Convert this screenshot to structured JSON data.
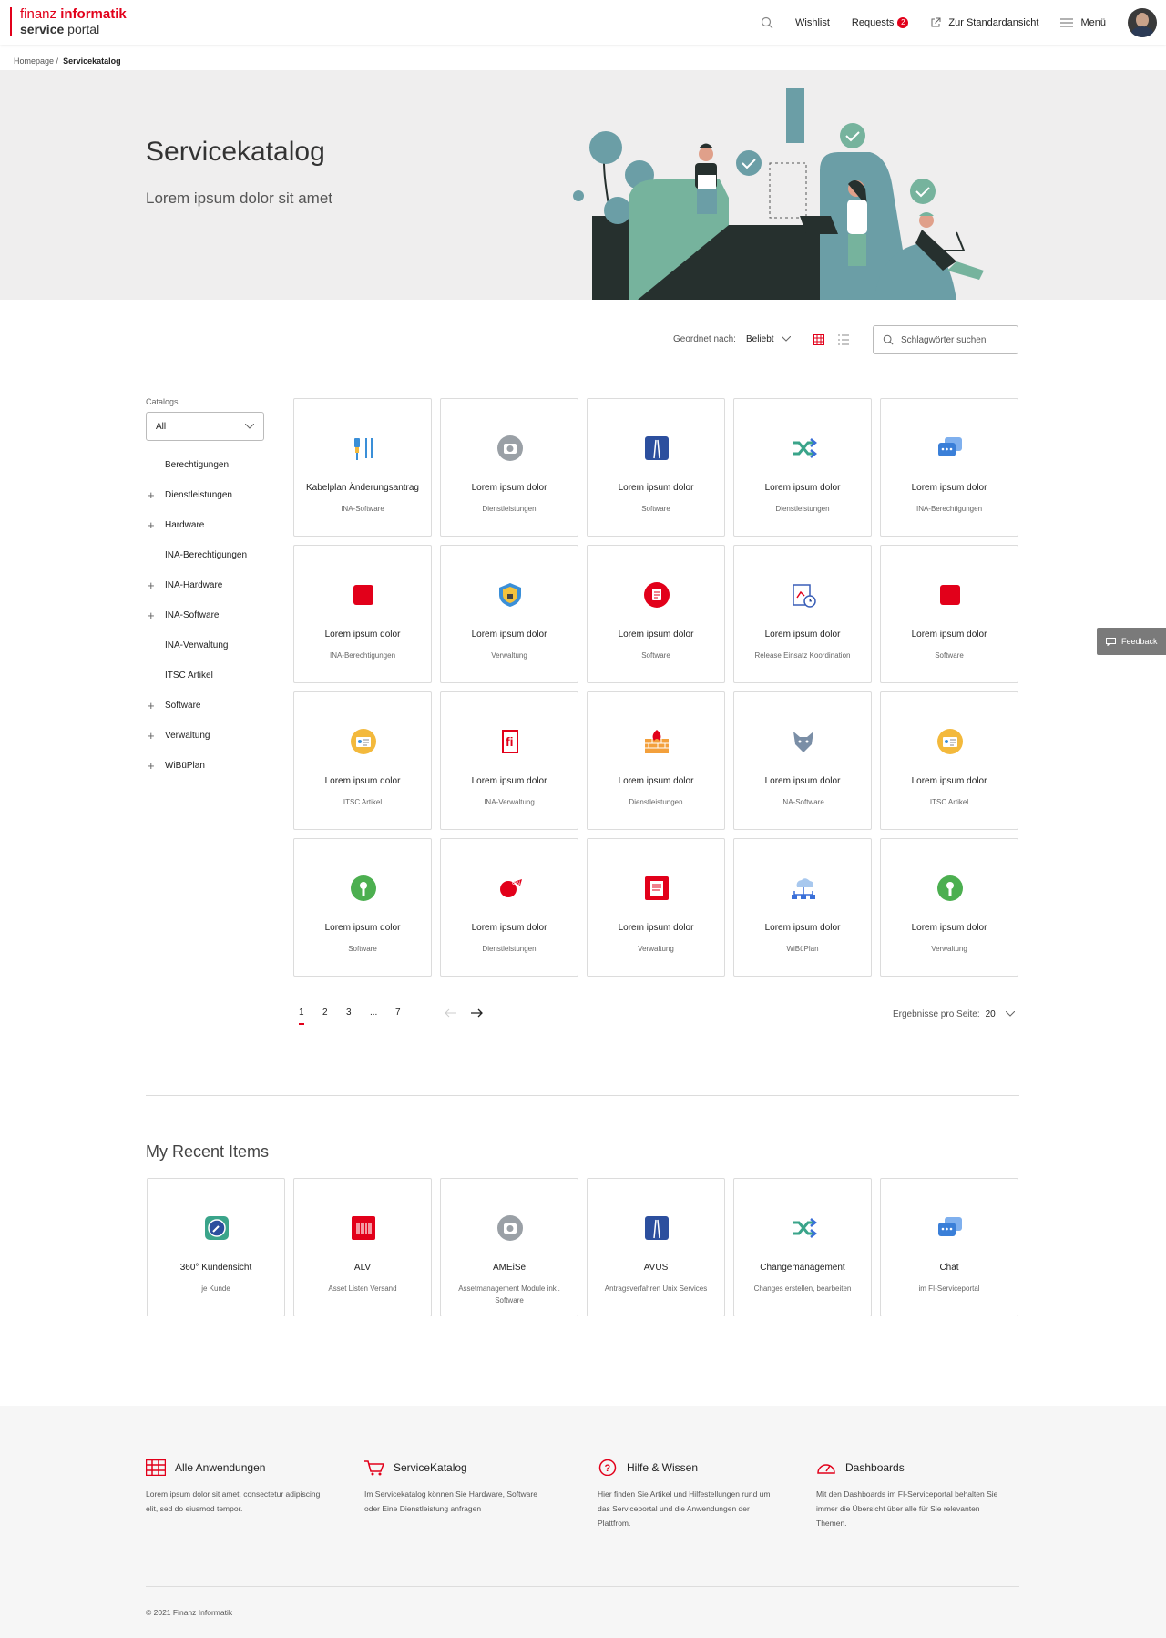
{
  "header": {
    "logo_line1_light": "finanz ",
    "logo_line1_bold": "informatik",
    "logo_line2_bold": "service",
    "logo_line2_light": " portal",
    "wishlist": "Wishlist",
    "requests": "Requests",
    "requests_badge": "2",
    "standard_view": "Zur Standardansicht",
    "menu": "Menü"
  },
  "breadcrumb": {
    "home": "Homepage",
    "sep": "/",
    "current": "Servicekatalog"
  },
  "hero": {
    "title": "Servicekatalog",
    "subtitle": "Lorem ipsum dolor sit amet"
  },
  "toolbar": {
    "sort_label": "Geordnet nach:",
    "sort_value": "Beliebt",
    "search_placeholder": "Schlagwörter suchen"
  },
  "sidebar": {
    "label": "Catalogs",
    "select_value": "All",
    "items": [
      {
        "label": "Berechtigungen",
        "expand": false
      },
      {
        "label": "Dienstleistungen",
        "expand": true
      },
      {
        "label": "Hardware",
        "expand": true
      },
      {
        "label": "INA-Berechtigungen",
        "expand": false
      },
      {
        "label": "INA-Hardware",
        "expand": true
      },
      {
        "label": "INA-Software",
        "expand": true
      },
      {
        "label": "INA-Verwaltung",
        "expand": false
      },
      {
        "label": "ITSC Artikel",
        "expand": false
      },
      {
        "label": "Software",
        "expand": true
      },
      {
        "label": "Verwaltung",
        "expand": true
      },
      {
        "label": "WiBüPlan",
        "expand": true
      }
    ]
  },
  "catalog": [
    {
      "title": "Kabelplan Änderungsantrag",
      "sub": "INA-Software",
      "icon": "cable-icon"
    },
    {
      "title": "Lorem ipsum dolor",
      "sub": "Dienstleistungen",
      "icon": "camera-icon"
    },
    {
      "title": "Lorem ipsum dolor",
      "sub": "Software",
      "icon": "road-icon"
    },
    {
      "title": "Lorem ipsum dolor",
      "sub": "Dienstleistungen",
      "icon": "shuffle-icon"
    },
    {
      "title": "Lorem ipsum dolor",
      "sub": "INA-Berechtigungen",
      "icon": "chat-icon"
    },
    {
      "title": "Lorem ipsum dolor",
      "sub": "INA-Berechtigungen",
      "icon": "red-square-icon"
    },
    {
      "title": "Lorem ipsum dolor",
      "sub": "Verwaltung",
      "icon": "shield-icon"
    },
    {
      "title": "Lorem ipsum dolor",
      "sub": "Software",
      "icon": "document-circle-icon"
    },
    {
      "title": "Lorem ipsum dolor",
      "sub": "Release Einsatz Koordination",
      "icon": "clipboard-clock-icon"
    },
    {
      "title": "Lorem ipsum dolor",
      "sub": "Software",
      "icon": "red-square-icon"
    },
    {
      "title": "Lorem ipsum dolor",
      "sub": "ITSC Artikel",
      "icon": "id-card-icon"
    },
    {
      "title": "Lorem ipsum dolor",
      "sub": "INA-Verwaltung",
      "icon": "fi-logo-icon"
    },
    {
      "title": "Lorem ipsum dolor",
      "sub": "Dienstleistungen",
      "icon": "firewall-icon"
    },
    {
      "title": "Lorem ipsum dolor",
      "sub": "INA-Software",
      "icon": "wolf-icon"
    },
    {
      "title": "Lorem ipsum dolor",
      "sub": "ITSC Artikel",
      "icon": "id-card-icon"
    },
    {
      "title": "Lorem ipsum dolor",
      "sub": "Software",
      "icon": "open-source-icon"
    },
    {
      "title": "Lorem ipsum dolor",
      "sub": "Dienstleistungen",
      "icon": "stamp-icon"
    },
    {
      "title": "Lorem ipsum dolor",
      "sub": "Verwaltung",
      "icon": "document-red-icon"
    },
    {
      "title": "Lorem ipsum dolor",
      "sub": "WiBüPlan",
      "icon": "cloud-network-icon"
    },
    {
      "title": "Lorem ipsum dolor",
      "sub": "Verwaltung",
      "icon": "open-source-icon"
    }
  ],
  "pagination": {
    "pages": [
      "1",
      "2",
      "3",
      "...",
      "7"
    ],
    "per_page_label": "Ergebnisse pro Seite:",
    "per_page_value": "20"
  },
  "recent": {
    "title": "My Recent Items",
    "items": [
      {
        "title": "360° Kundensicht",
        "sub": "je Kunde",
        "icon": "compass-icon"
      },
      {
        "title": "ALV",
        "sub": "Asset Listen Versand",
        "icon": "barcode-icon"
      },
      {
        "title": "AMEiSe",
        "sub": "Assetmanagement Module inkl. Software",
        "icon": "camera-icon"
      },
      {
        "title": "AVUS",
        "sub": "Antragsverfahren Unix Services",
        "icon": "road-icon"
      },
      {
        "title": "Changemanagement",
        "sub": "Changes erstellen, bearbeiten",
        "icon": "shuffle-icon"
      },
      {
        "title": "Chat",
        "sub": "im FI-Serviceportal",
        "icon": "chat-icon"
      }
    ]
  },
  "footer": {
    "cols": [
      {
        "title": "Alle Anwendungen",
        "text": "Lorem ipsum dolor sit amet, consectetur adipiscing elit, sed do eiusmod tempor.",
        "icon": "grid-icon"
      },
      {
        "title": "ServiceKatalog",
        "text": "Im Servicekatalog können Sie Hardware, Software oder Eine Dienstleistung anfragen",
        "icon": "cart-icon"
      },
      {
        "title": "Hilfe & Wissen",
        "text": "Hier finden Sie Artikel und Hilfestellungen rund um das Serviceportal und die Anwendungen der Plattfrom.",
        "icon": "help-icon"
      },
      {
        "title": "Dashboards",
        "text": "Mit den Dashboards im FI-Serviceportal behalten Sie immer die Übersicht über alle für Sie relevanten Themen.",
        "icon": "gauge-icon"
      }
    ],
    "copyright": "© 2021 Finanz Informatik"
  },
  "feedback": "Feedback",
  "colors": {
    "accent": "#e2001a",
    "teal": "#6b9ea6",
    "green": "#76b39d"
  }
}
